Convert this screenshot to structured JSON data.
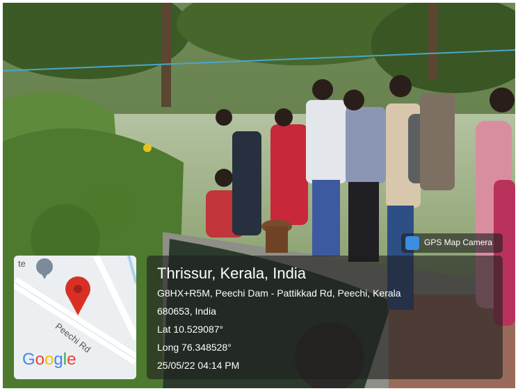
{
  "watermark": {
    "app_name": "GPS Map Camera",
    "location_title": "Thrissur, Kerala, India",
    "address_line_1": "G8HX+R5M, Peechi Dam - Pattikkad Rd, Peechi, Kerala",
    "address_line_2": "680653, India",
    "latitude": "Lat 10.529087°",
    "longitude": "Long 76.348528°",
    "datetime": "25/05/22 04:14 PM"
  },
  "map": {
    "road_label": "Peechi Rd",
    "partial_label": "te",
    "logo": "Google",
    "pin_color": "#d93025"
  },
  "icons": {
    "map_pin": "location-pin-icon",
    "app": "gps-map-camera-icon"
  }
}
